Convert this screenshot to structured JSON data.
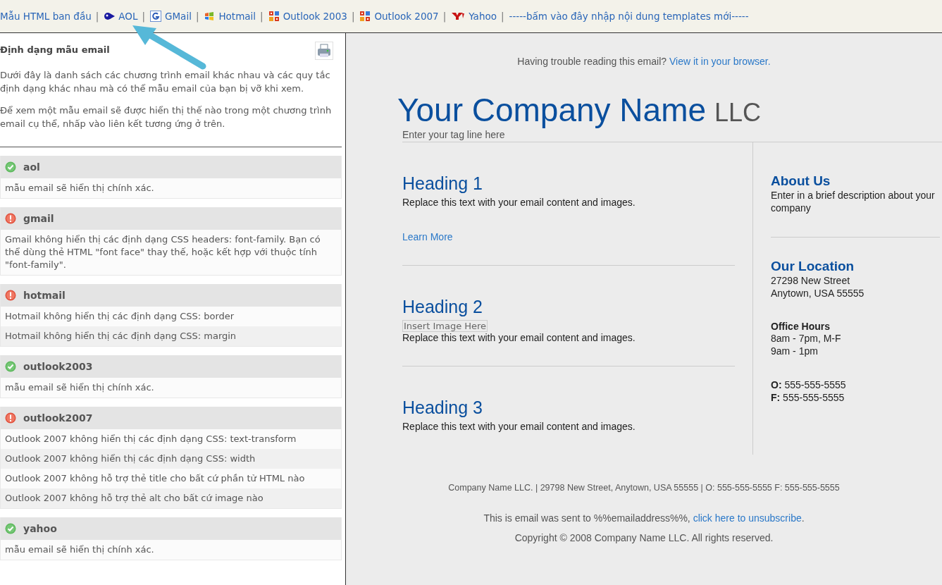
{
  "toolbar": {
    "links": [
      {
        "kind": "plain",
        "label": "Mẫu HTML ban đầu",
        "separator": "|"
      },
      {
        "kind": "aol",
        "label": "AOL",
        "separator": "|"
      },
      {
        "kind": "gmail",
        "label": "GMail",
        "separator": "|"
      },
      {
        "kind": "hotmail",
        "label": "Hotmail",
        "separator": "|"
      },
      {
        "kind": "outlook",
        "label": "Outlook 2003",
        "separator": "|"
      },
      {
        "kind": "outlook",
        "label": "Outlook 2007",
        "separator": "|"
      },
      {
        "kind": "yahoo",
        "label": "Yahoo",
        "separator": "|"
      },
      {
        "kind": "plain",
        "label": "-----bấm vào đây nhập nội dung templates mới-----"
      }
    ]
  },
  "sidebar": {
    "title": "Định dạng mẫu email",
    "paragraphs": [
      "Dưới đây là danh sách các chương trình email khác nhau và các quy tắc định dạng khác nhau mà có thể mẫu email của bạn bị vỡ khi xem.",
      "Để xem một mẫu email sẽ được hiển thị thế nào trong một chương trình email cụ thể, nhấp vào liên kết tương ứng ở trên."
    ],
    "clients": [
      {
        "name": "aol",
        "kind": "ok",
        "messages": [
          "mẫu email sẽ hiển thị chính xác."
        ]
      },
      {
        "name": "gmail",
        "kind": "error",
        "messages": [
          "Gmail không hiển thị các định dạng CSS headers: font-family. Bạn có thể dùng thẻ HTML \"font face\" thay thế, hoặc kết hợp với thuộc tính \"font-family\"."
        ]
      },
      {
        "name": "hotmail",
        "kind": "error",
        "messages": [
          "Hotmail không hiển thị các định dạng CSS: border",
          "Hotmail không hiển thị các định dạng CSS: margin"
        ]
      },
      {
        "name": "outlook2003",
        "kind": "ok",
        "messages": [
          "mẫu email sẽ hiển thị chính xác."
        ]
      },
      {
        "name": "outlook2007",
        "kind": "error",
        "messages": [
          "Outlook 2007 không hiển thị các định dạng CSS: text-transform",
          "Outlook 2007 không hiển thị các định dạng CSS: width",
          "Outlook 2007 không hỗ trợ thẻ title cho bất cứ phần tử HTML nào",
          "Outlook 2007 không hỗ trợ thẻ alt cho bất cứ image nào"
        ]
      },
      {
        "name": "yahoo",
        "kind": "ok",
        "messages": [
          "mẫu email sẽ hiển thị chính xác."
        ]
      }
    ]
  },
  "email": {
    "notice": {
      "text": "Having trouble reading this email?",
      "link": "View it in your browser."
    },
    "company": "Your Company Name",
    "suffix": "LLC",
    "tagline": "Enter your tag line here",
    "sections": [
      {
        "heading": "Heading 1",
        "text": "Replace this text with your email content and images.",
        "link": "Learn More"
      },
      {
        "heading": "Heading 2",
        "image": "Insert Image Here",
        "text": "Replace this text with your email content and images."
      },
      {
        "heading": "Heading 3",
        "text": "Replace this text with your email content and images."
      }
    ],
    "side": [
      {
        "heading": "About Us",
        "lines": [
          "Enter in a brief description about your company"
        ]
      },
      {
        "heading": "Our Location",
        "lines": [
          "27298 New Street",
          "Anytown, USA 55555"
        ]
      },
      {
        "subheading": "Office Hours",
        "lines": [
          "8am - 7pm, M-F",
          "9am - 1pm"
        ]
      },
      {
        "lines": [
          "**O:** 555-555-5555",
          "**F:** 555-555-5555"
        ]
      }
    ],
    "footer_address": "Company Name LLC. | 29798 New Street, Anytown, USA 55555 | O: 555-555-5555 F: 555-555-5555",
    "unsubscribe": {
      "text": "This is email was sent to %%emailaddress%%,",
      "link": "click here to unsubscribe",
      "suffix": "."
    },
    "copyright": "Copyright © 2008 Company Name LLC. All rights reserved."
  }
}
